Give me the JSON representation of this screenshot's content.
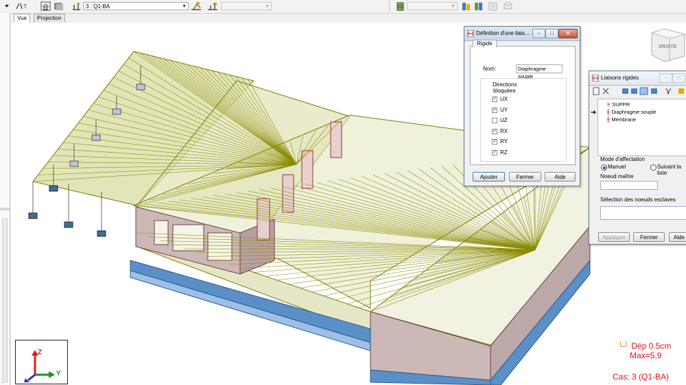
{
  "toolbar": {
    "case_combo": "3 : Q1-BA",
    "right_combo": "",
    "mid_combo": ""
  },
  "tabs": [
    {
      "label": "Vue"
    },
    {
      "label": "Projection"
    }
  ],
  "navcube": {
    "label": "DROITE"
  },
  "axes": {
    "z": "Z",
    "y": "Y"
  },
  "legend": {
    "dep": "Dép  0.5cm",
    "max": "Max=5,9",
    "cas": "Cas: 3 (Q1-BA)"
  },
  "dialog_def": {
    "title": "Définition d'une liais...",
    "tab": "Rigide",
    "name_label": "Nom:",
    "name_value": "Diaphragme souple",
    "directions_label_1": "Directions",
    "directions_label_2": "bloquées",
    "directions": [
      {
        "label": "UX",
        "checked": true
      },
      {
        "label": "UY",
        "checked": true
      },
      {
        "label": "UZ",
        "checked": false
      },
      {
        "label": "RX",
        "checked": true
      },
      {
        "label": "RY",
        "checked": true
      },
      {
        "label": "RZ",
        "checked": true
      }
    ],
    "btn_add": "Ajouter",
    "btn_close": "Fermer",
    "btn_help": "Aide"
  },
  "dialog_rigid": {
    "title": "Liaisons rigides",
    "items": [
      {
        "label": "SUPPR"
      },
      {
        "label": "Diaphragme souple"
      },
      {
        "label": "Membrane"
      }
    ],
    "mode_label": "Mode d'affectation",
    "mode_manual": "Manuel",
    "mode_follow": "Suivant la liste",
    "master_label": "Noeud maître",
    "slave_label": "Sélection des noeuds esclaves",
    "btn_apply": "Appliquer",
    "btn_close": "Fermer",
    "btn_help": "Aide"
  },
  "colors": {
    "accent_red": "#e0101a",
    "slab_fill": "#d8dca0",
    "lines": "#8a8a00",
    "mesh_blue": "#5b8fc7",
    "wall_fill": "#c8b4b4"
  }
}
